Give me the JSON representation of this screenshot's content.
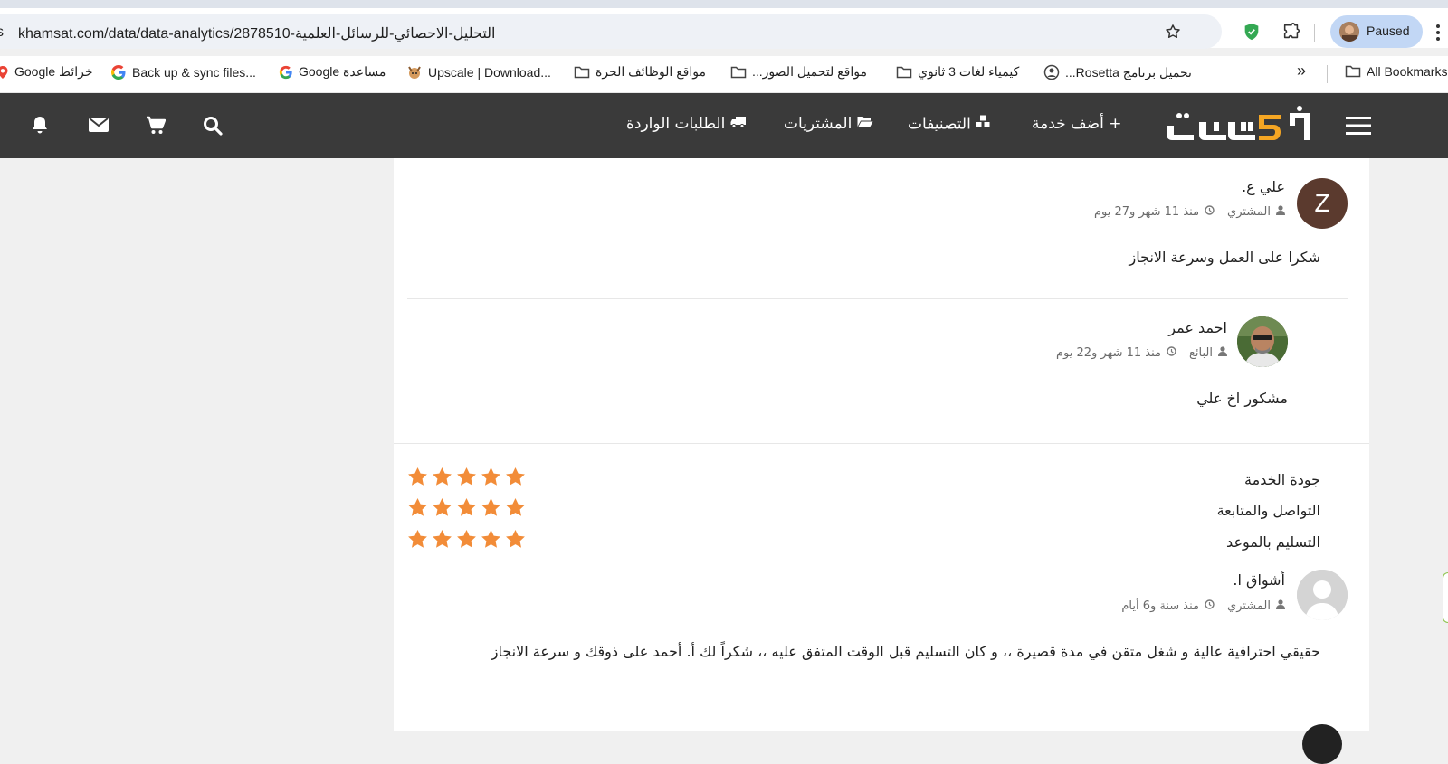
{
  "browser": {
    "url_lead": "s",
    "url": "khamsat.com/data/data-analytics/2878510-التحليل-الاحصائي-للرسائل-العلمية",
    "profile_label": "Paused",
    "bookmarks": [
      {
        "label": "خرائط Google",
        "icon": "maps-icon"
      },
      {
        "label": "Back up & sync files...",
        "icon": "google-icon"
      },
      {
        "label": "مساعدة Google",
        "icon": "google-icon"
      },
      {
        "label": "Upscale | Download...",
        "icon": "upscale-icon"
      },
      {
        "label": "مواقع الوظائف الحرة",
        "icon": "folder-icon"
      },
      {
        "label": "مواقع لتحميل الصور...",
        "icon": "folder-icon"
      },
      {
        "label": "كيمياء لغات 3 ثانوي",
        "icon": "folder-icon"
      },
      {
        "label": "تحميل برنامج Rosetta...",
        "icon": "rosetta-icon"
      }
    ],
    "more_bookmarks": "»",
    "all_bookmarks": "All Bookmarks"
  },
  "site": {
    "logo_text": "خمسات",
    "nav": [
      {
        "label": "+ أضف خدمة",
        "icon": "plus-icon"
      },
      {
        "label": "التصنيفات",
        "icon": "categories-icon"
      },
      {
        "label": "المشتريات",
        "icon": "folder-open-icon"
      },
      {
        "label": "الطلبات الواردة",
        "icon": "truck-icon"
      }
    ]
  },
  "reviews": [
    {
      "avatar_letter": "Z",
      "avatar_color": "#5b3a2e",
      "name": "علي ع.",
      "role": "المشتري",
      "time": "منذ 11 شهر و27 يوم",
      "text": "شكرا على العمل وسرعة الانجاز"
    },
    {
      "name": "احمد عمر",
      "role": "البائع",
      "time": "منذ 11 شهر و22 يوم",
      "text": "مشكور اخ علي"
    },
    {
      "ratings": [
        {
          "label": "جودة الخدمة",
          "stars": 5
        },
        {
          "label": "التواصل والمتابعة",
          "stars": 5
        },
        {
          "label": "التسليم بالموعد",
          "stars": 5
        }
      ],
      "name": "أشواق ا.",
      "role": "المشتري",
      "time": "منذ سنة و6 أيام",
      "text": "حقيقي احترافية عالية و شغل متقن في مدة قصيرة ،، و كان التسليم قبل الوقت المتفق عليه ،، شكراً لك أ. أحمد على ذوقك و سرعة الانجاز"
    }
  ],
  "colors": {
    "star": "#f28c38",
    "navbar": "#3a3a3a",
    "logo_accent": "#f5a623"
  }
}
